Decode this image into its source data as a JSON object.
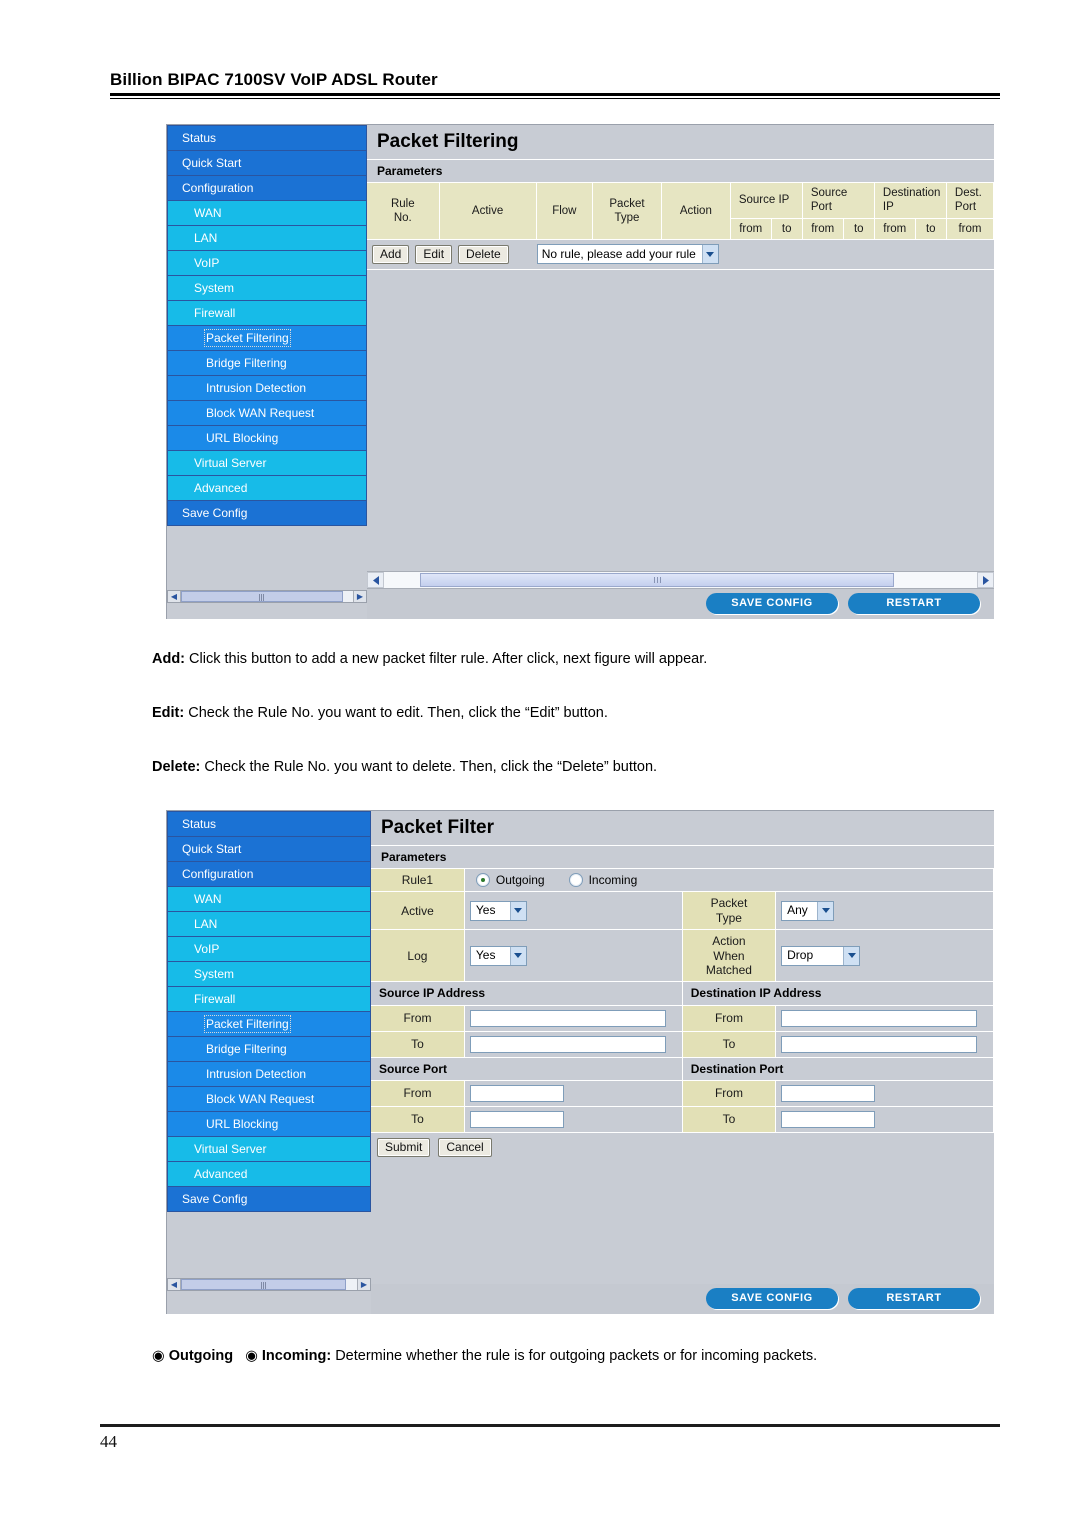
{
  "document": {
    "header_title": "Billion BIPAC 7100SV VoIP ADSL Router",
    "page_number": "44"
  },
  "sidebar": {
    "items": [
      {
        "label": "Status",
        "level": 0,
        "selected": false
      },
      {
        "label": "Quick Start",
        "level": 0,
        "selected": false
      },
      {
        "label": "Configuration",
        "level": 0,
        "selected": false
      },
      {
        "label": "WAN",
        "level": 1,
        "selected": false
      },
      {
        "label": "LAN",
        "level": 1,
        "selected": false
      },
      {
        "label": "VoIP",
        "level": 1,
        "selected": false
      },
      {
        "label": "System",
        "level": 1,
        "selected": false
      },
      {
        "label": "Firewall",
        "level": 1,
        "selected": false
      },
      {
        "label": "Packet Filtering",
        "level": 2,
        "selected": true
      },
      {
        "label": "Bridge Filtering",
        "level": 2,
        "selected": false
      },
      {
        "label": "Intrusion Detection",
        "level": 2,
        "selected": false
      },
      {
        "label": "Block WAN Request",
        "level": 2,
        "selected": false
      },
      {
        "label": "URL Blocking",
        "level": 2,
        "selected": false
      },
      {
        "label": "Virtual Server",
        "level": 1,
        "selected": false
      },
      {
        "label": "Advanced",
        "level": 1,
        "selected": false
      },
      {
        "label": "Save Config",
        "level": 0,
        "selected": false
      }
    ]
  },
  "figure1": {
    "title": "Packet Filtering",
    "subtitle": "Parameters",
    "columns": {
      "rule_no": "Rule\nNo.",
      "rule_no_l1": "Rule",
      "rule_no_l2": "No.",
      "active": "Active",
      "flow": "Flow",
      "packet_type_l1": "Packet",
      "packet_type_l2": "Type",
      "action": "Action",
      "source_ip": "Source IP",
      "source_port_l1": "Source",
      "source_port_l2": "Port",
      "destination_ip_l1": "Destination",
      "destination_ip_l2": "IP",
      "dest_port_l1": "Dest.",
      "dest_port_l2": "Port",
      "from": "from",
      "to": "to"
    },
    "buttons": {
      "add": "Add",
      "edit": "Edit",
      "delete": "Delete"
    },
    "rule_select_value": "No rule, please add your rule",
    "footer": {
      "save_config": "SAVE CONFIG",
      "restart": "RESTART"
    }
  },
  "descriptions": [
    {
      "term": "Add:",
      "text": " Click this button to add a new packet filter rule. After click, next figure will appear."
    },
    {
      "term": "Edit:",
      "text": " Check the Rule No. you want to edit. Then, click the “Edit” button."
    },
    {
      "term": "Delete:",
      "text": " Check the Rule No. you want to delete. Then, click the “Delete” button."
    }
  ],
  "figure2": {
    "title": "Packet Filter",
    "subtitle": "Parameters",
    "rule_label": "Rule1",
    "flow_options": {
      "outgoing": "Outgoing",
      "incoming": "Incoming",
      "selected": "Outgoing"
    },
    "fields": {
      "active_label": "Active",
      "active_value": "Yes",
      "packet_type_label_l1": "Packet",
      "packet_type_label_l2": "Type",
      "packet_type_value": "Any",
      "log_label": "Log",
      "log_value": "Yes",
      "action_label_l1": "Action",
      "action_label_l2": "When",
      "action_label_l3": "Matched",
      "action_value": "Drop"
    },
    "sections": {
      "source_ip": "Source IP Address",
      "destination_ip": "Destination IP Address",
      "source_port": "Source Port",
      "destination_port": "Destination Port"
    },
    "row_labels": {
      "from": "From",
      "to": "To"
    },
    "values": {
      "src_ip_from": "",
      "src_ip_to": "",
      "dst_ip_from": "",
      "dst_ip_to": "",
      "src_port_from": "",
      "src_port_to": "",
      "dst_port_from": "",
      "dst_port_to": ""
    },
    "buttons": {
      "submit": "Submit",
      "cancel": "Cancel"
    },
    "footer": {
      "save_config": "SAVE CONFIG",
      "restart": "RESTART"
    }
  },
  "bottom_note": {
    "outgoing": "Outgoing",
    "incoming": "Incoming:",
    "text": " Determine whether the rule is for outgoing packets or for incoming packets."
  },
  "colors": {
    "nav_top": "#1b72d4",
    "nav_sub": "#17bbe8",
    "nav_leaf": "#1b8ae8",
    "panel_bg": "#c8ccd4",
    "table_head": "#e6e5c2",
    "label_bg": "#e2e0b6",
    "pill_blue": "#1a7fc4"
  }
}
